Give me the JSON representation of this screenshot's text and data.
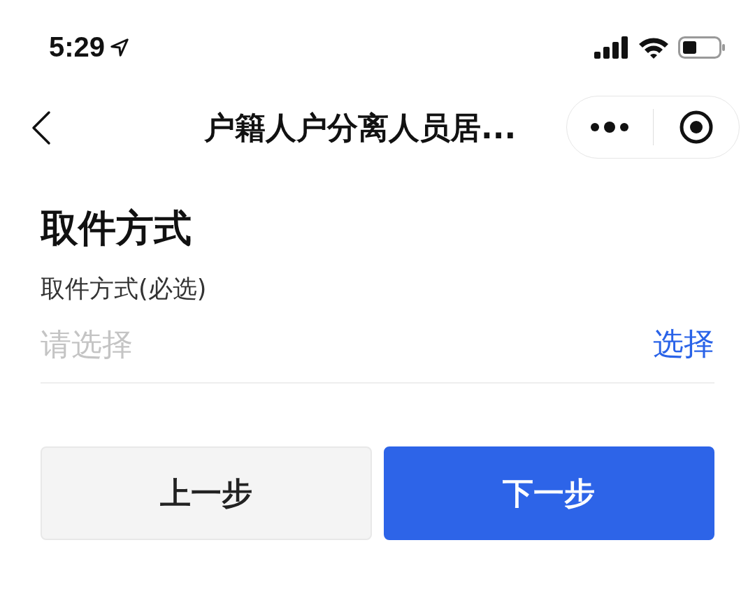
{
  "status_bar": {
    "time": "5:29"
  },
  "nav_bar": {
    "title": "户籍人户分离人员居..."
  },
  "section": {
    "title": "取件方式",
    "field": {
      "label": "取件方式(必选)",
      "placeholder": "请选择",
      "action": "选择"
    }
  },
  "buttons": [
    {
      "label": "上一步",
      "kind": "secondary"
    },
    {
      "label": "下一步",
      "kind": "primary"
    }
  ]
}
